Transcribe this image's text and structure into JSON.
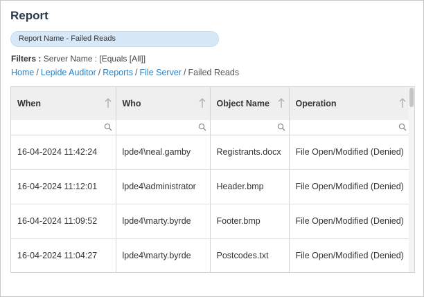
{
  "report": {
    "title": "Report",
    "name_pill": "Report Name - Failed Reads",
    "filters_label": "Filters :",
    "filters_value": "Server Name : [Equals [All]]"
  },
  "breadcrumb": {
    "items": [
      "Home",
      "Lepide Auditor",
      "Reports",
      "File Server"
    ],
    "current": "Failed Reads",
    "separator": "/"
  },
  "table": {
    "columns": [
      "When",
      "Who",
      "Object Name",
      "Operation"
    ],
    "rows": [
      [
        "16-04-2024 11:42:24",
        "lpde4\\neal.gamby",
        "Registrants.docx",
        "File Open/Modified (Denied)"
      ],
      [
        "16-04-2024 11:12:01",
        "lpde4\\administrator",
        "Header.bmp",
        "File Open/Modified (Denied)"
      ],
      [
        "16-04-2024 11:09:52",
        "lpde4\\marty.byrde",
        "Footer.bmp",
        "File Open/Modified (Denied)"
      ],
      [
        "16-04-2024 11:04:27",
        "lpde4\\marty.byrde",
        "Postcodes.txt",
        "File Open/Modified (Denied)"
      ]
    ]
  },
  "colors": {
    "accent_link": "#2a7fc4",
    "pill_bg": "#d7e9f8",
    "header_bg": "#efefef",
    "title": "#2b3a4a"
  },
  "icons": {
    "sort": "arrow-up-icon",
    "filter": "search-icon"
  }
}
